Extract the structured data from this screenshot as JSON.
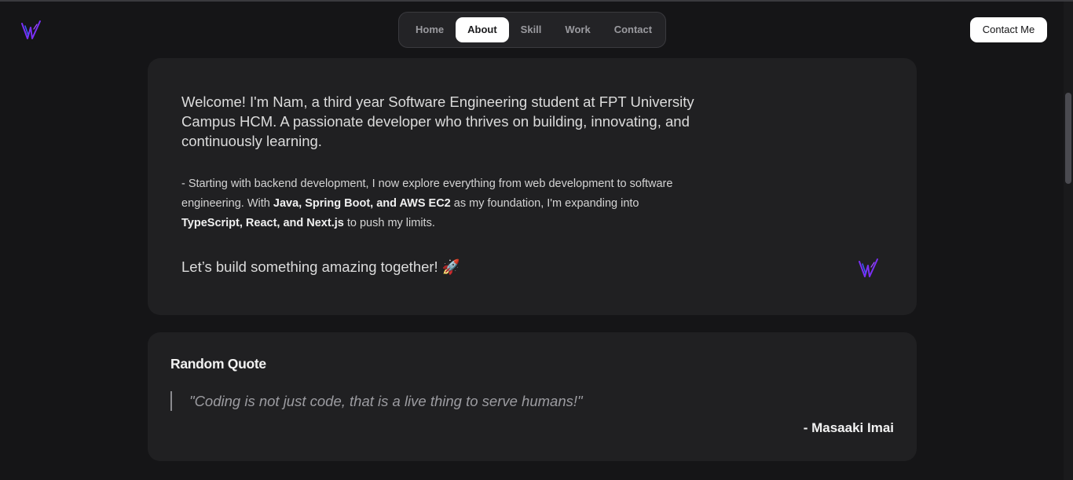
{
  "nav": {
    "items": [
      {
        "label": "Home"
      },
      {
        "label": "About",
        "active": true
      },
      {
        "label": "Skill"
      },
      {
        "label": "Work"
      },
      {
        "label": "Contact"
      }
    ]
  },
  "header": {
    "contact_button": "Contact Me"
  },
  "about": {
    "intro": "Welcome! I'm Nam, a third year Software Engineering student at FPT University Campus HCM. A passionate developer who thrives on building, innovating, and continuously learning.",
    "details": {
      "part1": "- Starting with backend development, I now explore everything from web development to software engineering. With ",
      "bold1": "Java, Spring Boot, and AWS EC2",
      "part2": " as my foundation, I'm expanding into ",
      "bold2": "TypeScript, React, and Next.js",
      "part3": " to push my limits."
    },
    "cta": "Let’s build something amazing together! 🚀"
  },
  "quote": {
    "title": "Random Quote",
    "text": "\"Coding is not just code, that is a live thing to serve humans!\"",
    "author": "- Masaaki Imai"
  },
  "colors": {
    "background": "#151517",
    "card": "#202022",
    "logo_purple": "#7b2ff7",
    "logo_blue": "#3b5bff"
  }
}
